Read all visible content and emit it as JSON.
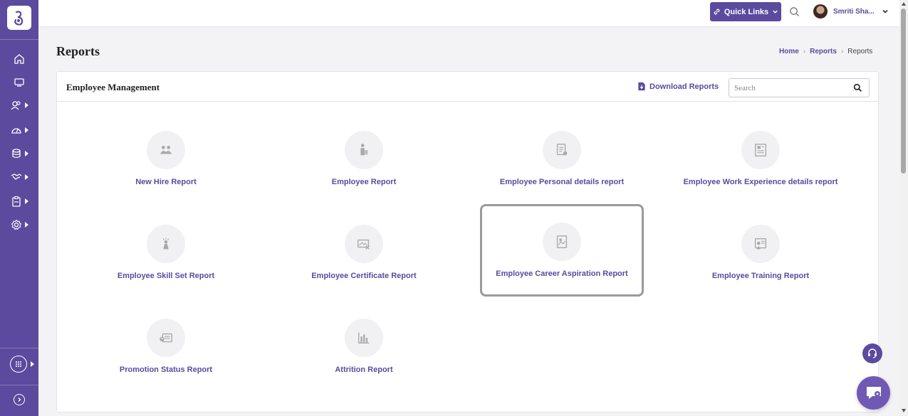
{
  "app": {
    "logo_icon": "app-logo-icon"
  },
  "topbar": {
    "quick_links_label": "Quick Links",
    "user_name": "Smriti Sha..."
  },
  "sidebar": {
    "items": [
      {
        "icon": "home-icon",
        "has_submenu": false
      },
      {
        "icon": "monitor-icon",
        "has_submenu": false
      },
      {
        "icon": "users-icon",
        "has_submenu": true
      },
      {
        "icon": "gauge-icon",
        "has_submenu": true
      },
      {
        "icon": "database-icon",
        "has_submenu": true
      },
      {
        "icon": "handshake-icon",
        "has_submenu": true
      },
      {
        "icon": "clipboard-icon",
        "has_submenu": true
      },
      {
        "icon": "settings-icon",
        "has_submenu": true
      }
    ]
  },
  "page": {
    "title": "Reports",
    "breadcrumb": [
      "Home",
      "Reports",
      "Reports"
    ]
  },
  "card": {
    "title": "Employee Management",
    "download_label": "Download Reports",
    "search_placeholder": "Search"
  },
  "reports": [
    {
      "label": "New Hire Report",
      "icon": "new-hire-icon"
    },
    {
      "label": "Employee Report",
      "icon": "employee-icon"
    },
    {
      "label": "Employee Personal details report",
      "icon": "personal-details-icon"
    },
    {
      "label": "Employee Work Experience details report",
      "icon": "work-experience-icon"
    },
    {
      "label": "Employee Skill Set Report",
      "icon": "skill-set-icon"
    },
    {
      "label": "Employee Certificate Report",
      "icon": "certificate-icon"
    },
    {
      "label": "Employee Career Aspiration Report",
      "icon": "career-aspiration-icon",
      "selected": true
    },
    {
      "label": "Employee Training Report",
      "icon": "training-icon"
    },
    {
      "label": "Promotion Status Report",
      "icon": "promotion-status-icon"
    },
    {
      "label": "Attrition Report",
      "icon": "attrition-icon"
    }
  ],
  "colors": {
    "primary": "#5b4a9e",
    "sidebar": "#5b4a9e",
    "tile_bg": "#f1f1f3",
    "icon_gray": "#9a9aa2"
  }
}
